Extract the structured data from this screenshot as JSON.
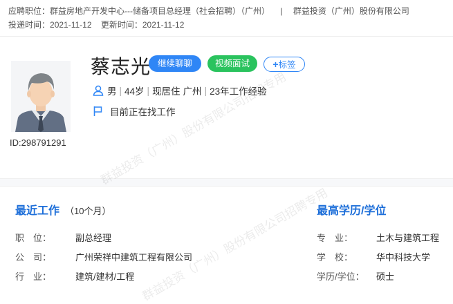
{
  "header": {
    "position_label": "应聘职位：",
    "position_value": "群益房地产开发中心---储备项目总经理（社会招聘）（广州）",
    "divider": "|",
    "company": "群益投资（广州）股份有限公司",
    "delivered_label": "投递时间：",
    "delivered_value": "2021-11-12",
    "updated_label": "更新时间：",
    "updated_value": "2021-11-12"
  },
  "profile": {
    "name": "蔡志光",
    "id_text": "ID:298791291",
    "buttons": {
      "chat": "继续聊聊",
      "video": "视频面试",
      "tag": "标签"
    },
    "gender": "男",
    "age": "44岁",
    "residence_label": "现居住",
    "residence_value": "广州",
    "experience": "23年工作经验",
    "job_status": "目前正在找工作"
  },
  "recent_job": {
    "title": "最近工作",
    "duration": "（10个月）",
    "rows": [
      {
        "label": "职　位：",
        "value": "副总经理"
      },
      {
        "label": "公　司：",
        "value": "广州荣祥中建筑工程有限公司"
      },
      {
        "label": "行　业：",
        "value": "建筑/建材/工程"
      }
    ]
  },
  "education": {
    "title": "最高学历/学位",
    "rows": [
      {
        "label": "专　业：",
        "value": "土木与建筑工程"
      },
      {
        "label": "学　校：",
        "value": "华中科技大学"
      },
      {
        "label": "学历/学位：",
        "value": "硕士"
      }
    ]
  },
  "watermarks": [
    "群益投资（广州）股份有限公司招聘专用",
    "群益投资（广州）股份有限公司招聘专用"
  ],
  "colors": {
    "accent_blue": "#2f86f6",
    "accent_green": "#2ac35e",
    "section_title": "#1e6fd9"
  },
  "icons": {
    "user": "user-icon",
    "flag": "flag-icon",
    "plus": "plus-icon",
    "avatar": "avatar-placeholder"
  }
}
